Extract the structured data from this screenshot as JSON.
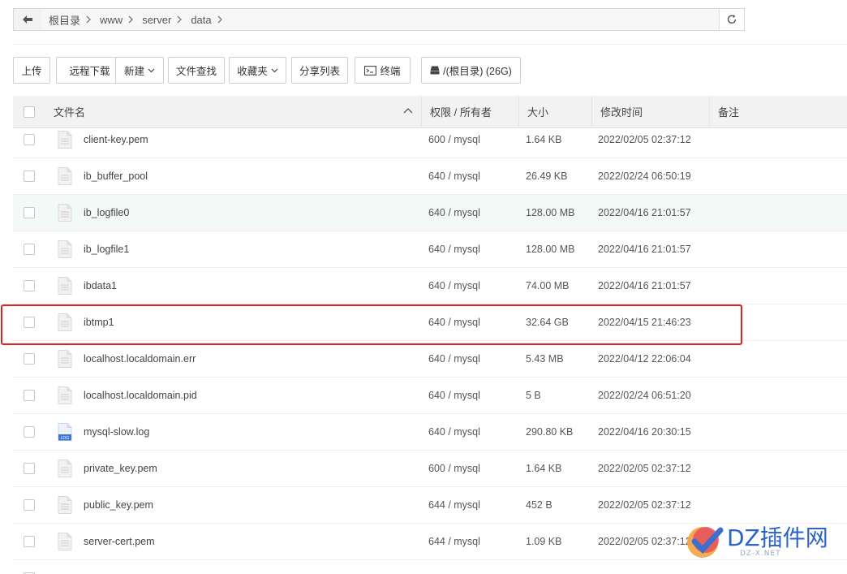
{
  "breadcrumb": {
    "items": [
      "根目录",
      "www",
      "server",
      "data"
    ]
  },
  "toolbar": {
    "upload": "上传",
    "remote_download": "远程下载",
    "new": "新建",
    "file_search": "文件查找",
    "favorites": "收藏夹",
    "share_list": "分享列表",
    "terminal": "终端",
    "disk": "/(根目录) (26G)"
  },
  "table": {
    "headers": {
      "name": "文件名",
      "perm": "权限 / 所有者",
      "size": "大小",
      "mtime": "修改时间",
      "note": "备注"
    },
    "rows": [
      {
        "name": "client-key.pem",
        "perm": "600 / mysql",
        "size": "1.64 KB",
        "mtime": "2022/02/05 02:37:12",
        "icon": "file-icon"
      },
      {
        "name": "ib_buffer_pool",
        "perm": "640 / mysql",
        "size": "26.49 KB",
        "mtime": "2022/02/24 06:50:19",
        "icon": "file-icon"
      },
      {
        "name": "ib_logfile0",
        "perm": "640 / mysql",
        "size": "128.00 MB",
        "mtime": "2022/04/16 21:01:57",
        "icon": "file-icon"
      },
      {
        "name": "ib_logfile1",
        "perm": "640 / mysql",
        "size": "128.00 MB",
        "mtime": "2022/04/16 21:01:57",
        "icon": "file-icon"
      },
      {
        "name": "ibdata1",
        "perm": "640 / mysql",
        "size": "74.00 MB",
        "mtime": "2022/04/16 21:01:57",
        "icon": "file-icon"
      },
      {
        "name": "ibtmp1",
        "perm": "640 / mysql",
        "size": "32.64 GB",
        "mtime": "2022/04/15 21:46:23",
        "icon": "file-icon"
      },
      {
        "name": "localhost.localdomain.err",
        "perm": "640 / mysql",
        "size": "5.43 MB",
        "mtime": "2022/04/12 22:06:04",
        "icon": "file-icon"
      },
      {
        "name": "localhost.localdomain.pid",
        "perm": "640 / mysql",
        "size": "5 B",
        "mtime": "2022/02/24 06:51:20",
        "icon": "file-icon"
      },
      {
        "name": "mysql-slow.log",
        "perm": "640 / mysql",
        "size": "290.80 KB",
        "mtime": "2022/04/16 20:30:15",
        "icon": "log-file-icon"
      },
      {
        "name": "private_key.pem",
        "perm": "600 / mysql",
        "size": "1.64 KB",
        "mtime": "2022/02/05 02:37:12",
        "icon": "file-icon"
      },
      {
        "name": "public_key.pem",
        "perm": "644 / mysql",
        "size": "452 B",
        "mtime": "2022/02/05 02:37:12",
        "icon": "file-icon"
      },
      {
        "name": "server-cert.pem",
        "perm": "644 / mysql",
        "size": "1.09 KB",
        "mtime": "2022/02/05 02:37:12",
        "icon": "file-icon"
      }
    ]
  },
  "watermark": {
    "text": "DZ插件网",
    "sub": "DZ-X.NET"
  },
  "colors": {
    "highlight": "#e0231f",
    "hover_row": "#f3f9f7"
  }
}
